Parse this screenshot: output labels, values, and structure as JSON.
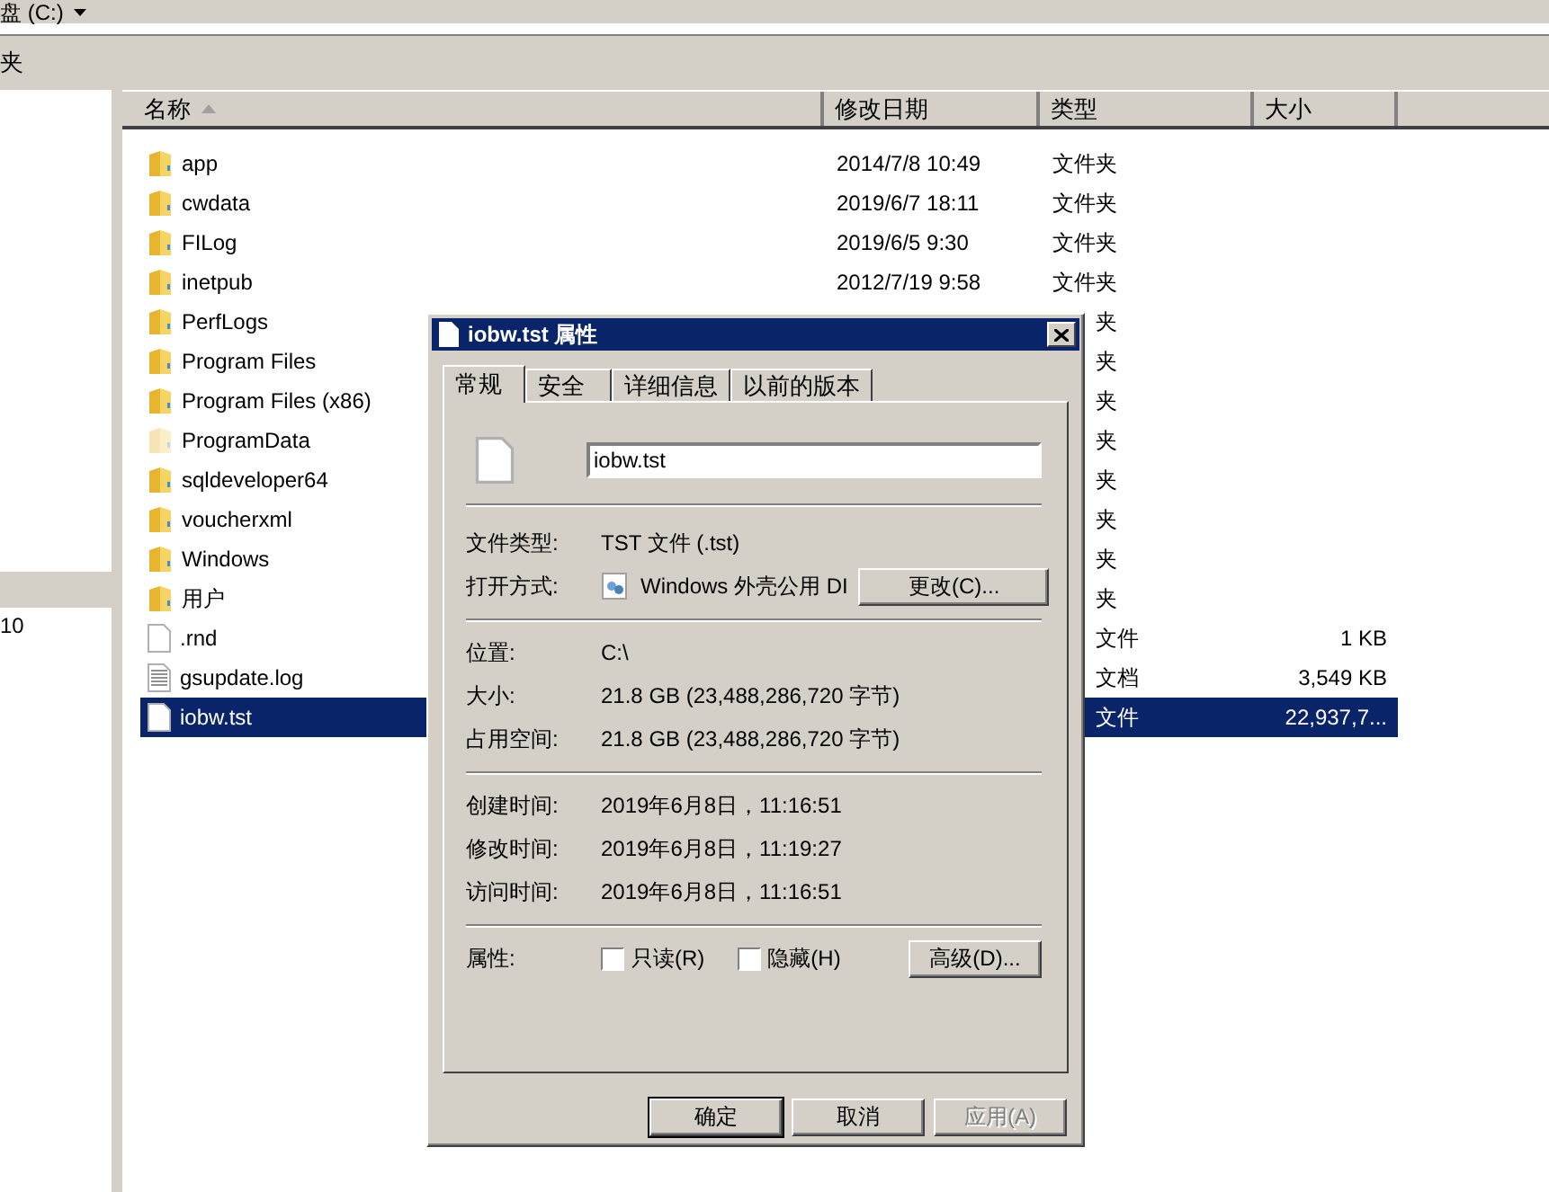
{
  "address_bar": {
    "path": "盘 (C:)"
  },
  "toolbar": {
    "label": "夹"
  },
  "nav_pane": {
    "items": [
      {
        "selected": true
      },
      {
        "label": "10",
        "selected": false
      }
    ]
  },
  "file_list": {
    "columns": [
      {
        "label": "名称",
        "sorted": true
      },
      {
        "label": "修改日期",
        "sorted": false
      },
      {
        "label": "类型",
        "sorted": false
      },
      {
        "label": "大小",
        "sorted": false
      }
    ],
    "rows": [
      {
        "kind": "folder",
        "name": "app",
        "date": "2014/7/8 10:49",
        "type": "文件夹",
        "selected": false
      },
      {
        "kind": "folder",
        "name": "cwdata",
        "date": "2019/6/7 18:11",
        "type": "文件夹",
        "selected": false
      },
      {
        "kind": "folder",
        "name": "FILog",
        "date": "2019/6/5 9:30",
        "type": "文件夹",
        "selected": false
      },
      {
        "kind": "folder",
        "name": "inetpub",
        "date": "2012/7/19 9:58",
        "type": "文件夹",
        "selected": false
      },
      {
        "kind": "folder",
        "name": "PerfLogs",
        "type": "夹",
        "selected": false
      },
      {
        "kind": "folder",
        "name": "Program Files",
        "type": "夹",
        "selected": false
      },
      {
        "kind": "folder",
        "name": "Program Files (x86)",
        "type": "夹",
        "selected": false
      },
      {
        "kind": "hidden_folder",
        "name": "ProgramData",
        "type": "夹",
        "selected": false
      },
      {
        "kind": "folder",
        "name": "sqldeveloper64",
        "type": "夹",
        "selected": false
      },
      {
        "kind": "folder",
        "name": "voucherxml",
        "type": "夹",
        "selected": false
      },
      {
        "kind": "folder",
        "name": "Windows",
        "type": "夹",
        "selected": false
      },
      {
        "kind": "folder",
        "name": "用户",
        "type": "夹",
        "selected": false
      },
      {
        "kind": "file",
        "name": ".rnd",
        "type": "文件",
        "size": "1 KB",
        "selected": false
      },
      {
        "kind": "text",
        "name": "gsupdate.log",
        "type": "文档",
        "size": "3,549 KB",
        "selected": false
      },
      {
        "kind": "file",
        "name": "iobw.tst",
        "type": "文件",
        "size": "22,937,7...",
        "selected": true
      }
    ]
  },
  "dialog": {
    "title": "iobw.tst 属性",
    "tabs": [
      {
        "label": "常规",
        "selected": true
      },
      {
        "label": "安全",
        "selected": false
      },
      {
        "label": "详细信息",
        "selected": false
      },
      {
        "label": "以前的版本",
        "selected": false
      }
    ],
    "file_name": "iobw.tst",
    "groups": [
      [
        {
          "kind": "text",
          "label": "文件类型:",
          "value": "TST 文件 (.tst)"
        },
        {
          "kind": "app",
          "label": "打开方式:",
          "value": "Windows 外壳公用 DI",
          "button": "更改(C)..."
        }
      ],
      [
        {
          "kind": "text",
          "label": "位置:",
          "value": "C:\\"
        },
        {
          "kind": "text",
          "label": "大小:",
          "value": "21.8 GB (23,488,286,720 字节)"
        },
        {
          "kind": "text",
          "label": "占用空间:",
          "value": "21.8 GB (23,488,286,720 字节)"
        }
      ],
      [
        {
          "kind": "text",
          "label": "创建时间:",
          "value": "2019年6月8日，11:16:51"
        },
        {
          "kind": "text",
          "label": "修改时间:",
          "value": "2019年6月8日，11:19:27"
        },
        {
          "kind": "text",
          "label": "访问时间:",
          "value": "2019年6月8日，11:16:51"
        }
      ]
    ],
    "attributes": {
      "label": "属性:",
      "options": [
        {
          "label": "只读(R)",
          "checked": false
        },
        {
          "label": "隐藏(H)",
          "checked": false
        }
      ],
      "button": "高级(D)..."
    },
    "buttons": [
      {
        "label": "确定",
        "default": true,
        "disabled": false
      },
      {
        "label": "取消",
        "default": false,
        "disabled": false
      },
      {
        "label": "应用(A)",
        "default": false,
        "disabled": true
      }
    ]
  }
}
